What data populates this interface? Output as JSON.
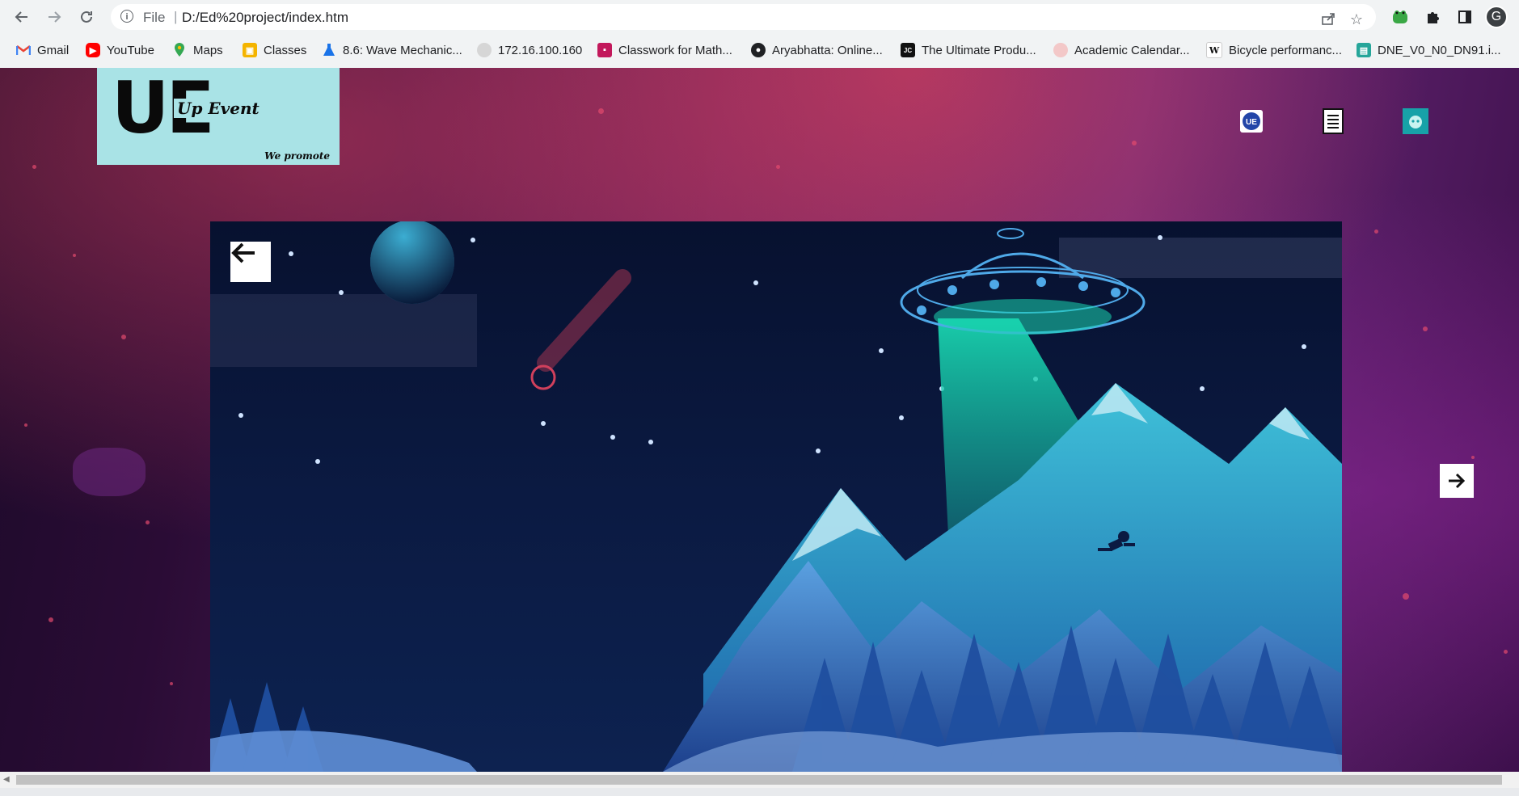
{
  "browser": {
    "url_scheme": "File",
    "url": "D:/Ed%20project/index.htm",
    "profile_initial": "G",
    "nav_icons": [
      "back-arrow-icon",
      "forward-arrow-icon",
      "reload-icon"
    ],
    "omnibox_icons": [
      "info-icon",
      "share-icon",
      "star-icon"
    ],
    "extension_icons": [
      "frog-extension-icon",
      "puzzle-extension-icon",
      "side-panel-icon"
    ]
  },
  "bookmarks": [
    {
      "label": "Gmail",
      "icon": "gmail-icon",
      "color": "#ea4335"
    },
    {
      "label": "YouTube",
      "icon": "youtube-icon",
      "color": "#ff0000"
    },
    {
      "label": "Maps",
      "icon": "maps-icon",
      "color": "#34a853"
    },
    {
      "label": "Classes",
      "icon": "classroom-icon",
      "color": "#f4b400"
    },
    {
      "label": "8.6: Wave Mechanic...",
      "icon": "flask-icon",
      "color": "#1a73e8"
    },
    {
      "label": "172.16.100.160",
      "icon": "seal-icon",
      "color": "#b0b0b0"
    },
    {
      "label": "Classwork for Math...",
      "icon": "classwork-icon",
      "color": "#c2185b"
    },
    {
      "label": "Aryabhatta: Online...",
      "icon": "globe-icon",
      "color": "#202124"
    },
    {
      "label": "The Ultimate Produ...",
      "icon": "jc-icon",
      "color": "#111111"
    },
    {
      "label": "Academic Calendar...",
      "icon": "calendar-seal-icon",
      "color": "#e8a0a0"
    },
    {
      "label": "Bicycle performanc...",
      "icon": "wikipedia-icon",
      "color": "#ffffff"
    },
    {
      "label": "DNE_V0_N0_DN91.i...",
      "icon": "document-icon",
      "color": "#26a69a"
    }
  ],
  "site": {
    "logo_letters": "UE",
    "logo_name": "Up Event",
    "logo_tagline": "We promote",
    "logo_bg": "#a9e3e6",
    "header_icons": [
      "ue-badge-icon",
      "document-list-icon",
      "robot-icon"
    ]
  },
  "carousel": {
    "prev_icon": "arrow-left-icon",
    "next_icon": "arrow-right-icon",
    "slide_description_icon": "ufo-mountain-illustration"
  }
}
